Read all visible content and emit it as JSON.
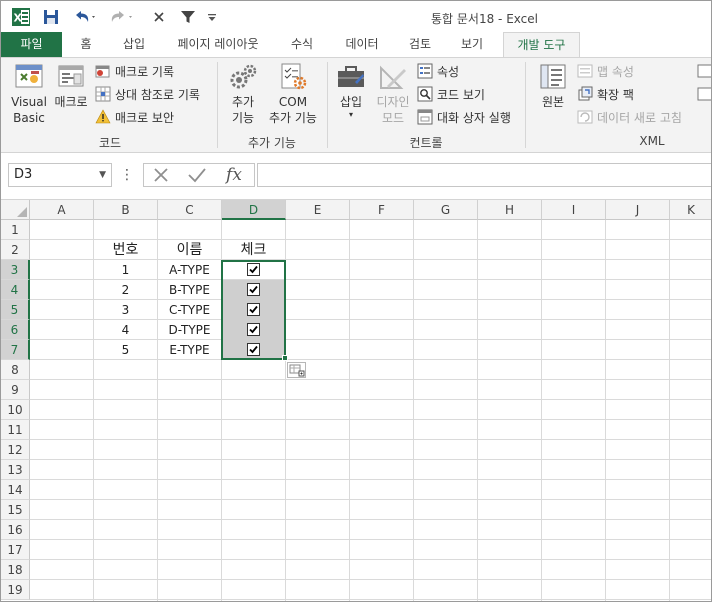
{
  "window": {
    "title": "통합 문서18 - Excel"
  },
  "quick_access": {
    "icons": [
      "excel-logo-icon",
      "save-icon",
      "undo-icon",
      "redo-icon",
      "clear-icon",
      "filter-icon",
      "customize-icon"
    ]
  },
  "tabs": [
    {
      "label": "파일"
    },
    {
      "label": "홈"
    },
    {
      "label": "삽입"
    },
    {
      "label": "페이지 레이아웃"
    },
    {
      "label": "수식"
    },
    {
      "label": "데이터"
    },
    {
      "label": "검토"
    },
    {
      "label": "보기"
    },
    {
      "label": "개발 도구"
    }
  ],
  "ribbon": {
    "code": {
      "label": "코드",
      "visual_basic_line1": "Visual",
      "visual_basic_line2": "Basic",
      "macro": "매크로",
      "record_macro": "매크로 기록",
      "relative_ref": "상대 참조로 기록",
      "macro_security": "매크로 보안"
    },
    "addins": {
      "label": "추가 기능",
      "addins_line1": "추가",
      "addins_line2": "기능",
      "com_line1": "COM",
      "com_line2": "추가 기능"
    },
    "controls": {
      "label": "컨트롤",
      "insert": "삽입",
      "design_line1": "디자인",
      "design_line2": "모드",
      "properties": "속성",
      "view_code": "코드 보기",
      "run_dialog": "대화 상자 실행"
    },
    "xml": {
      "label": "XML",
      "source": "원본",
      "map_properties": "맵 속성",
      "expansion_packs": "확장 팩",
      "refresh_data": "데이터 새로 고침"
    }
  },
  "formula_bar": {
    "name_box": "D3",
    "formula": ""
  },
  "sheet": {
    "columns": [
      "A",
      "B",
      "C",
      "D",
      "E",
      "F",
      "G",
      "H",
      "I",
      "J",
      "K"
    ],
    "rows": [
      "1",
      "2",
      "3",
      "4",
      "5",
      "6",
      "7",
      "8",
      "9",
      "10",
      "11",
      "12",
      "13",
      "14",
      "15",
      "16",
      "17",
      "18",
      "19"
    ],
    "headers": {
      "no": "번호",
      "name": "이름",
      "check": "체크"
    },
    "data": [
      {
        "no": "1",
        "name": "A-TYPE",
        "checked": true
      },
      {
        "no": "2",
        "name": "B-TYPE",
        "checked": true
      },
      {
        "no": "3",
        "name": "C-TYPE",
        "checked": true
      },
      {
        "no": "4",
        "name": "D-TYPE",
        "checked": true
      },
      {
        "no": "5",
        "name": "E-TYPE",
        "checked": true
      }
    ],
    "selected_range": "D3:D7"
  },
  "colors": {
    "excel_green": "#217346",
    "ribbon_bg": "#f3f3f3",
    "selection_fill": "#cfcfcf"
  }
}
